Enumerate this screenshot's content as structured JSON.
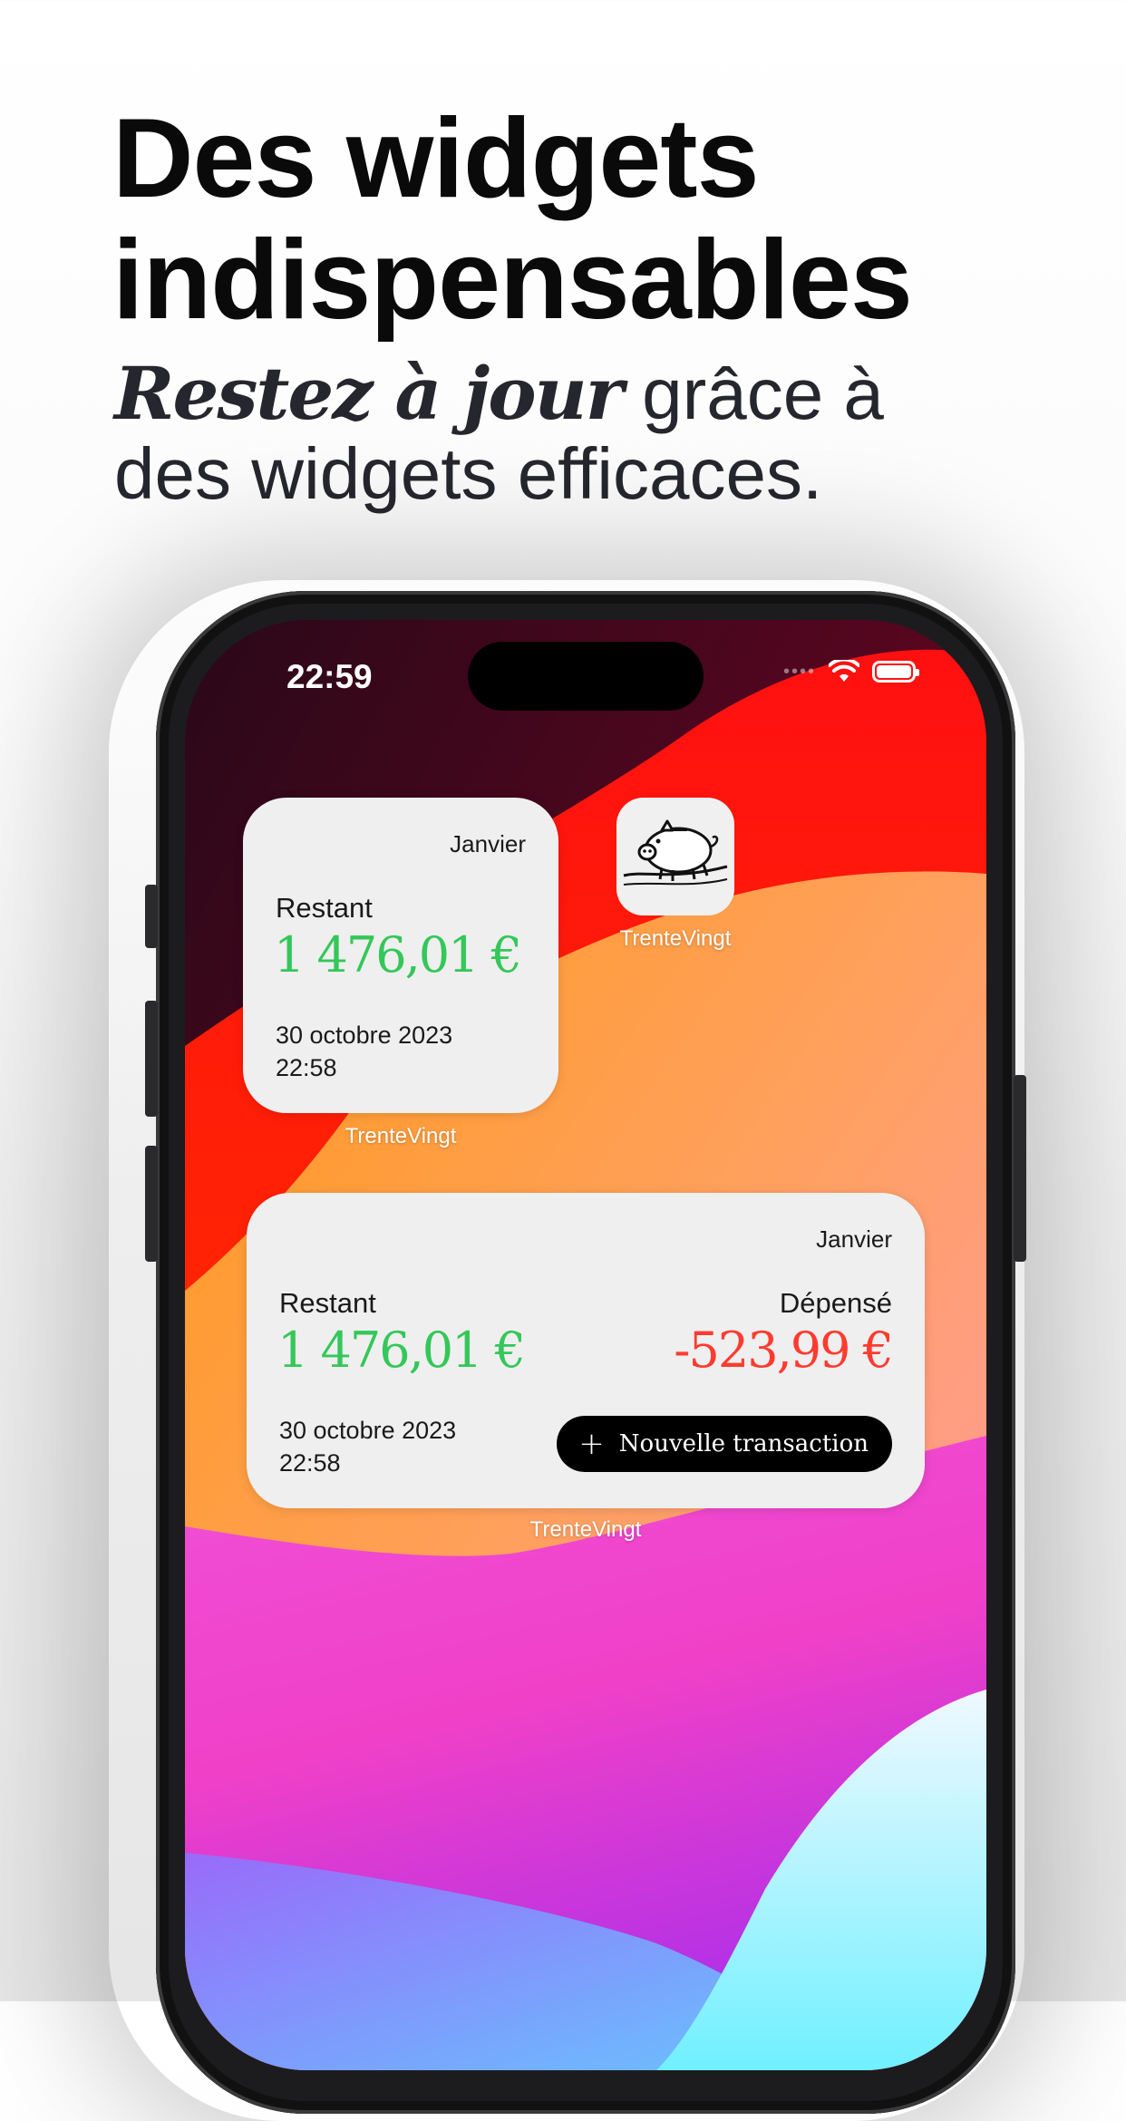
{
  "header": {
    "title_line1": "Des widgets",
    "title_line2": "indispensables",
    "subtitle_accent": "Restez à jour",
    "subtitle_rest1": " grâce à",
    "subtitle_line2": "des widgets efficaces."
  },
  "status_bar": {
    "time": "22:59",
    "dots": "••••",
    "icons": [
      "wifi-icon",
      "battery-icon"
    ]
  },
  "small_widget": {
    "month": "Janvier",
    "remaining_label": "Restant",
    "remaining_amount": "1 476,01 €",
    "date": "30 octobre 2023",
    "time": "22:58",
    "caption": "TrenteVingt"
  },
  "app_icon": {
    "name": "TrenteVingt",
    "icon": "piggy-bank-icon"
  },
  "medium_widget": {
    "month": "Janvier",
    "remaining_label": "Restant",
    "remaining_amount": "1 476,01 €",
    "spent_label": "Dépensé",
    "spent_amount": "-523,99 €",
    "date": "30 octobre 2023",
    "time": "22:58",
    "new_transaction_label": "Nouvelle transaction",
    "caption": "TrenteVingt"
  },
  "colors": {
    "positive": "#34c759",
    "negative": "#ff3b30",
    "widget_bg": "#efefef"
  }
}
